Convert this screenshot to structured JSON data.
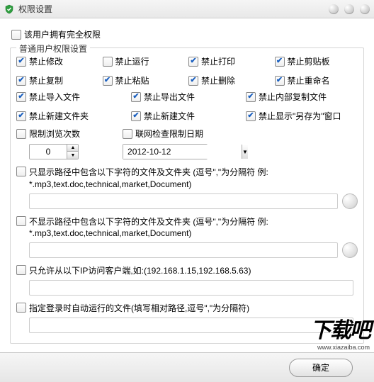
{
  "title": "权限设置",
  "full_perm_label": "该用户拥有完全权限",
  "fieldset_legend": "普通用户权限设置",
  "perms4": [
    {
      "label": "禁止修改",
      "checked": true
    },
    {
      "label": "禁止运行",
      "checked": false
    },
    {
      "label": "禁止打印",
      "checked": true
    },
    {
      "label": "禁止剪贴板",
      "checked": true
    },
    {
      "label": "禁止复制",
      "checked": true
    },
    {
      "label": "禁止粘贴",
      "checked": true
    },
    {
      "label": "禁止删除",
      "checked": true
    },
    {
      "label": "禁止重命名",
      "checked": true
    }
  ],
  "perms3": [
    {
      "label": "禁止导入文件",
      "checked": true
    },
    {
      "label": "禁止导出文件",
      "checked": true
    },
    {
      "label": "禁止内部复制文件",
      "checked": true
    },
    {
      "label": "禁止新建文件夹",
      "checked": true
    },
    {
      "label": "禁止新建文件",
      "checked": true
    },
    {
      "label": "禁止显示\"另存为\"窗口",
      "checked": true
    }
  ],
  "limit_views": {
    "label": "限制浏览次数",
    "value": "0"
  },
  "net_check": {
    "label": "联网检查限制日期",
    "value": "2012-10-12"
  },
  "filters": {
    "show_only": "只显示路径中包含以下字符的文件及文件夹 (逗号\",\"为分隔符 例: *.mp3,text.doc,technical,market,Document)",
    "hide": "不显示路径中包含以下字符的文件及文件夹 (逗号\",\"为分隔符 例: *.mp3,text.doc,technical,market,Document)",
    "ip": "只允许从以下IP访问客户端,如:(192.168.1.15,192.168.5.63)",
    "autorun": "指定登录时自动运行的文件(填写相对路径,逗号\",\"为分隔符)"
  },
  "ok_label": "确定",
  "watermark": {
    "main": "下载吧",
    "sub": "www.xiazaiba.com"
  }
}
